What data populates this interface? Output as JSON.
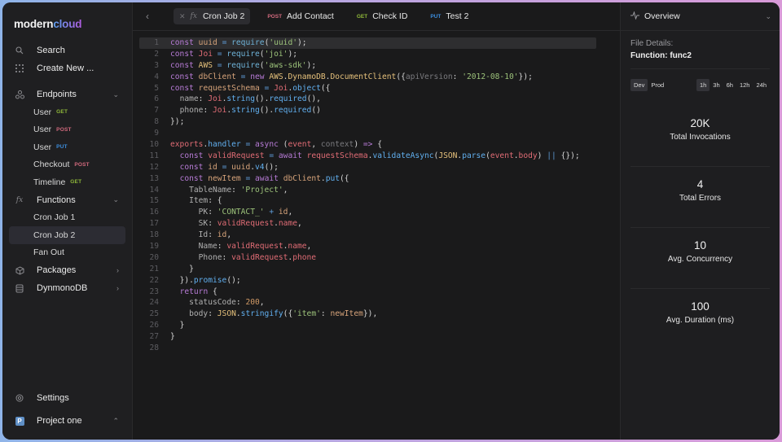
{
  "app": {
    "logo_primary": "modern",
    "logo_accent": "cloud"
  },
  "sidebar": {
    "search_label": "Search",
    "create_label": "Create New ...",
    "endpoints": {
      "label": "Endpoints",
      "items": [
        {
          "label": "User",
          "method": "GET"
        },
        {
          "label": "User",
          "method": "POST"
        },
        {
          "label": "User",
          "method": "PUT"
        },
        {
          "label": "Checkout",
          "method": "POST"
        },
        {
          "label": "Timeline",
          "method": "GET"
        }
      ]
    },
    "functions": {
      "label": "Functions",
      "items": [
        {
          "label": "Cron Job 1"
        },
        {
          "label": "Cron Job 2",
          "active": true
        },
        {
          "label": "Fan Out"
        }
      ]
    },
    "packages_label": "Packages",
    "dynamodb_label": "DynmonoDB",
    "settings_label": "Settings",
    "project": {
      "initial": "P",
      "label": "Project one"
    }
  },
  "tabs": [
    {
      "label": "Cron Job 2",
      "kind": "fx",
      "active": true
    },
    {
      "label": "Add Contact",
      "method": "POST"
    },
    {
      "label": "Check ID",
      "method": "GET"
    },
    {
      "label": "Test 2",
      "method": "PUT"
    }
  ],
  "editor": {
    "current_line": 1,
    "lines": [
      "const uuid = require('uuid');",
      "const Joi = require('joi');",
      "const AWS = require('aws-sdk');",
      "const dbClient = new AWS.DynamoDB.DocumentClient({apiVersion: '2012-08-10'});",
      "const requestSchema = Joi.object({",
      "  name: Joi.string().required(),",
      "  phone: Joi.string().required()",
      "});",
      "",
      "exports.handler = async (event, context) => {",
      "  const validRequest = await requestSchema.validateAsync(JSON.parse(event.body) || {});",
      "  const id = uuid.v4();",
      "  const newItem = await dbClient.put({",
      "    TableName: 'Project',",
      "    Item: {",
      "      PK: 'CONTACT_' + id,",
      "      SK: validRequest.name,",
      "      Id: id,",
      "      Name: validRequest.name,",
      "      Phone: validRequest.phone",
      "    }",
      "  }).promise();",
      "  return {",
      "    statusCode: 200,",
      "    body: JSON.stringify({'item': newItem}),",
      "  }",
      "}",
      ""
    ]
  },
  "panel": {
    "title": "Overview",
    "details_label": "File Details:",
    "details_value": "Function: func2",
    "env_options": [
      "Dev",
      "Prod"
    ],
    "env_selected": "Dev",
    "range_options": [
      "1h",
      "3h",
      "6h",
      "12h",
      "24h"
    ],
    "range_selected": "1h",
    "stats": [
      {
        "value": "20K",
        "label": "Total Invocations"
      },
      {
        "value": "4",
        "label": "Total Errors"
      },
      {
        "value": "10",
        "label": "Avg. Concurrency"
      },
      {
        "value": "100",
        "label": "Avg. Duration (ms)"
      }
    ]
  },
  "colors": {
    "get": "#8fb83a",
    "post": "#d36a7e",
    "put": "#3d8fe0"
  }
}
